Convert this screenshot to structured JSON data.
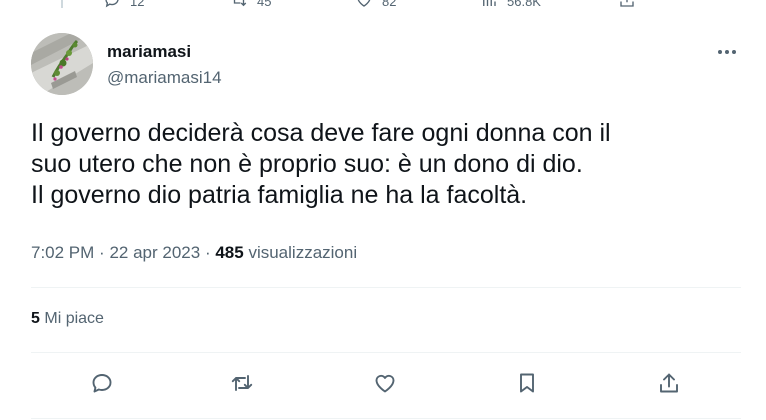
{
  "previous_tweet": {
    "counts": [
      "12",
      "45",
      "82",
      "56.8K"
    ]
  },
  "author": {
    "name": "mariamasi",
    "handle": "@mariamasi14"
  },
  "tweet": {
    "lines": [
      "Il governo deciderà cosa deve fare ogni donna con il",
      "suo utero che non è proprio suo: è un dono di dio.",
      "Il governo dio patria famiglia ne ha la facoltà."
    ]
  },
  "meta": {
    "time": "7:02 PM",
    "sep1": "·",
    "date": "22 apr 2023",
    "sep2": "·",
    "views_count": "485",
    "views_label": "visualizzazioni"
  },
  "likes": {
    "count": "5",
    "label": "Mi piace"
  },
  "actions": [
    {
      "icon": "reply-icon"
    },
    {
      "icon": "retweet-icon"
    },
    {
      "icon": "heart-icon"
    },
    {
      "icon": "bookmark-icon"
    },
    {
      "icon": "share-icon"
    }
  ],
  "colors": {
    "text": "#0f1419",
    "secondary": "#536471",
    "divider": "#eff3f4"
  }
}
